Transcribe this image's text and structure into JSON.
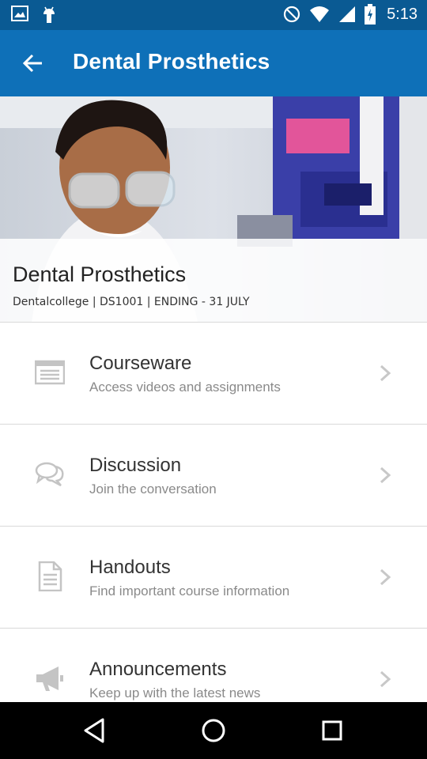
{
  "status_bar": {
    "time": "5:13",
    "icons_left": [
      "image-icon",
      "android-icon"
    ],
    "icons_right": [
      "do-not-disturb-icon",
      "wifi-icon",
      "signal-icon",
      "battery-charging-icon"
    ]
  },
  "app_bar": {
    "title": "Dental Prosthetics",
    "color": "#0e70b8"
  },
  "hero": {
    "course_title": "Dental Prosthetics",
    "course_meta": "Dentalcollege | DS1001 | ENDING - 31 JULY"
  },
  "menu": [
    {
      "label": "Courseware",
      "subtitle": "Access videos and assignments",
      "icon": "courseware-list-icon"
    },
    {
      "label": "Discussion",
      "subtitle": "Join the conversation",
      "icon": "discussion-bubbles-icon"
    },
    {
      "label": "Handouts",
      "subtitle": "Find important course information",
      "icon": "handout-document-icon"
    },
    {
      "label": "Announcements",
      "subtitle": "Keep up with the latest news",
      "icon": "megaphone-icon"
    }
  ],
  "nav_bar": {
    "buttons": [
      "back-triangle-icon",
      "home-circle-icon",
      "recents-square-icon"
    ]
  }
}
